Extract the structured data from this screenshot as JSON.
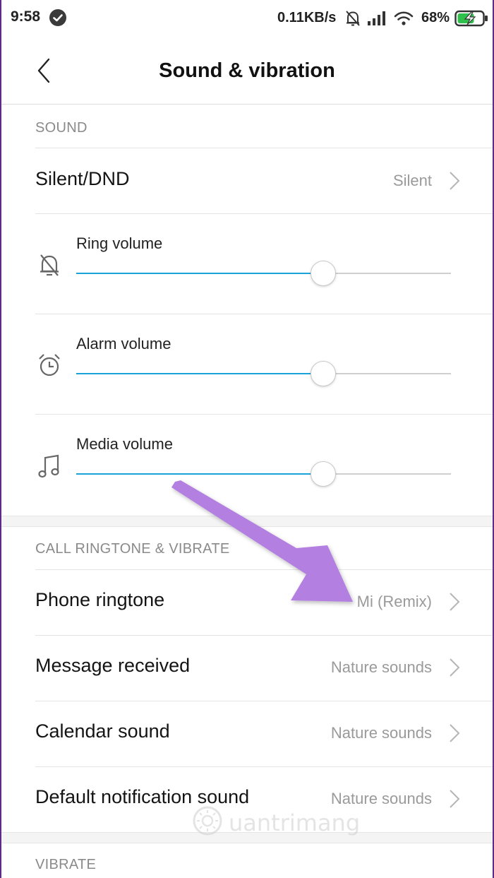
{
  "status_bar": {
    "time": "9:58",
    "net_speed": "0.11KB/s",
    "battery": "68%",
    "icons": [
      "check-circle-icon",
      "mute-bell-icon",
      "signal-icon",
      "wifi-icon",
      "battery-charging-icon"
    ]
  },
  "header": {
    "title": "Sound & vibration",
    "back_icon": "chevron-left-icon"
  },
  "sections": {
    "sound": "SOUND",
    "call": "CALL RINGTONE & VIBRATE",
    "vibrate": "VIBRATE"
  },
  "silent": {
    "label": "Silent/DND",
    "value": "Silent"
  },
  "sliders": [
    {
      "label": "Ring volume",
      "icon": "bell-off-icon",
      "level": 0.66
    },
    {
      "label": "Alarm volume",
      "icon": "alarm-clock-icon",
      "level": 0.66
    },
    {
      "label": "Media volume",
      "icon": "music-note-icon",
      "level": 0.66
    }
  ],
  "ringtones": [
    {
      "label": "Phone ringtone",
      "value": "Mi (Remix)"
    },
    {
      "label": "Message received",
      "value": "Nature sounds"
    },
    {
      "label": "Calendar sound",
      "value": "Nature sounds"
    },
    {
      "label": "Default notification sound",
      "value": "Nature sounds"
    }
  ],
  "colors": {
    "accent": "#1aa3d9",
    "annotation_arrow": "#b37fe0"
  },
  "watermark": "uantrimang"
}
